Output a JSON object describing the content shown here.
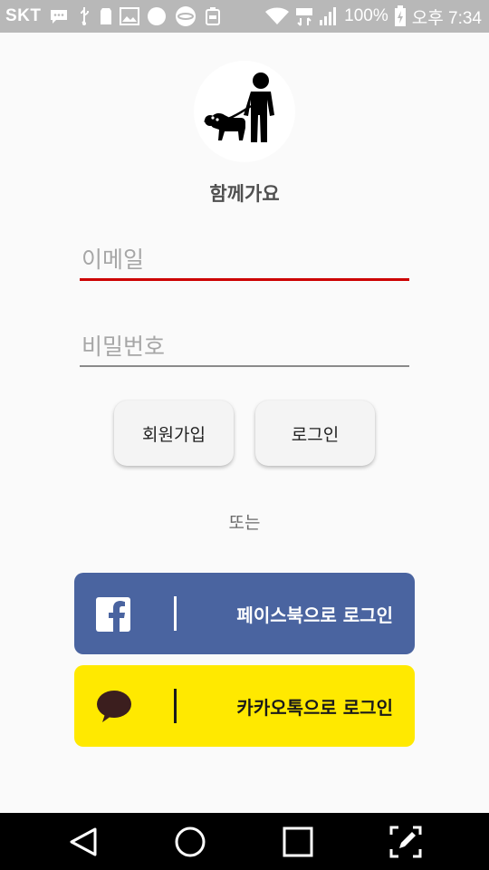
{
  "status_bar": {
    "carrier": "SKT",
    "battery_percent": "100%",
    "time": "오후 7:34",
    "left_icons": [
      "message-icon",
      "usb-icon",
      "sd-card-icon",
      "image-icon",
      "circle-icon",
      "planet-icon",
      "notification-100-icon"
    ],
    "right_icons": [
      "wifi-icon",
      "lte-icon",
      "signal-icon",
      "battery-charging-icon"
    ]
  },
  "logo": {
    "icon": "person-walking-dog-icon",
    "app_name": "함께가요"
  },
  "form": {
    "email_placeholder": "이메일",
    "password_placeholder": "비밀번호",
    "active_underline_color": "#cc0000"
  },
  "buttons": {
    "signup_label": "회원가입",
    "login_label": "로그인"
  },
  "or_text": "또는",
  "social": {
    "facebook": {
      "label": "페이스북으로 로그인",
      "color": "#4a64a0",
      "icon": "facebook-icon"
    },
    "kakao": {
      "label": "카카오톡으로 로그인",
      "color": "#ffe900",
      "icon": "kakaotalk-bubble-icon"
    }
  },
  "nav_bar": {
    "icons": [
      "back-icon",
      "home-icon",
      "recents-icon",
      "edit-screenshot-icon"
    ]
  }
}
